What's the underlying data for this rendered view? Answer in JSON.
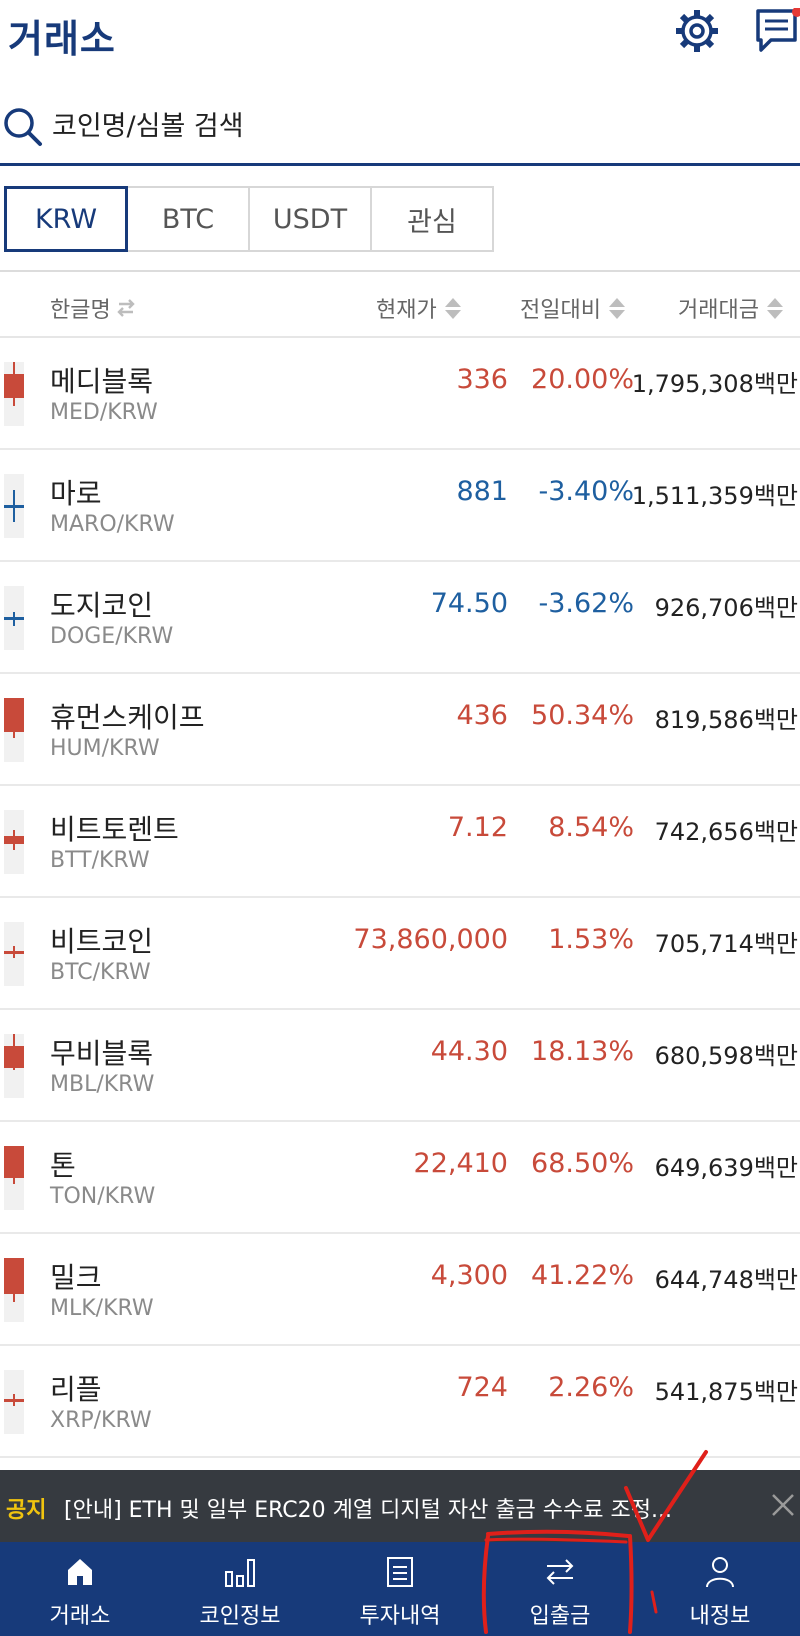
{
  "header": {
    "title": "거래소",
    "settings_icon": "gear-icon",
    "message_icon": "chat-icon"
  },
  "search": {
    "placeholder": "코인명/심볼 검색",
    "icon": "search-icon"
  },
  "tabs": [
    {
      "label": "KRW",
      "active": true
    },
    {
      "label": "BTC",
      "active": false
    },
    {
      "label": "USDT",
      "active": false
    },
    {
      "label": "관심",
      "active": false
    }
  ],
  "columns": {
    "name": "한글명",
    "price": "현재가",
    "change": "전일대비",
    "volume": "거래대금"
  },
  "colors": {
    "brand": "#173a7a",
    "up": "#c84a3a",
    "down": "#1e5fa0",
    "notice_bg": "#363a40",
    "notice_badge": "#f1c40f"
  },
  "rows": [
    {
      "name": "메디블록",
      "symbol": "MED/KRW",
      "price": "336",
      "change": "20.00%",
      "volume": "1,795,308백만",
      "direction": "up"
    },
    {
      "name": "마로",
      "symbol": "MARO/KRW",
      "price": "881",
      "change": "-3.40%",
      "volume": "1,511,359백만",
      "direction": "down"
    },
    {
      "name": "도지코인",
      "symbol": "DOGE/KRW",
      "price": "74.50",
      "change": "-3.62%",
      "volume": "926,706백만",
      "direction": "down"
    },
    {
      "name": "휴먼스케이프",
      "symbol": "HUM/KRW",
      "price": "436",
      "change": "50.34%",
      "volume": "819,586백만",
      "direction": "up"
    },
    {
      "name": "비트토렌트",
      "symbol": "BTT/KRW",
      "price": "7.12",
      "change": "8.54%",
      "volume": "742,656백만",
      "direction": "up"
    },
    {
      "name": "비트코인",
      "symbol": "BTC/KRW",
      "price": "73,860,000",
      "change": "1.53%",
      "volume": "705,714백만",
      "direction": "up"
    },
    {
      "name": "무비블록",
      "symbol": "MBL/KRW",
      "price": "44.30",
      "change": "18.13%",
      "volume": "680,598백만",
      "direction": "up"
    },
    {
      "name": "톤",
      "symbol": "TON/KRW",
      "price": "22,410",
      "change": "68.50%",
      "volume": "649,639백만",
      "direction": "up"
    },
    {
      "name": "밀크",
      "symbol": "MLK/KRW",
      "price": "4,300",
      "change": "41.22%",
      "volume": "644,748백만",
      "direction": "up"
    },
    {
      "name": "리플",
      "symbol": "XRP/KRW",
      "price": "724",
      "change": "2.26%",
      "volume": "541,875백만",
      "direction": "up"
    }
  ],
  "notice": {
    "badge": "공지",
    "text": "[안내] ETH 및 일부 ERC20 계열 디지털 자산 출금 수수료 조정..."
  },
  "nav": [
    {
      "label": "거래소",
      "icon": "home-icon"
    },
    {
      "label": "코인정보",
      "icon": "bar-chart-icon"
    },
    {
      "label": "투자내역",
      "icon": "document-icon"
    },
    {
      "label": "입출금",
      "icon": "transfer-icon"
    },
    {
      "label": "내정보",
      "icon": "user-icon"
    }
  ]
}
